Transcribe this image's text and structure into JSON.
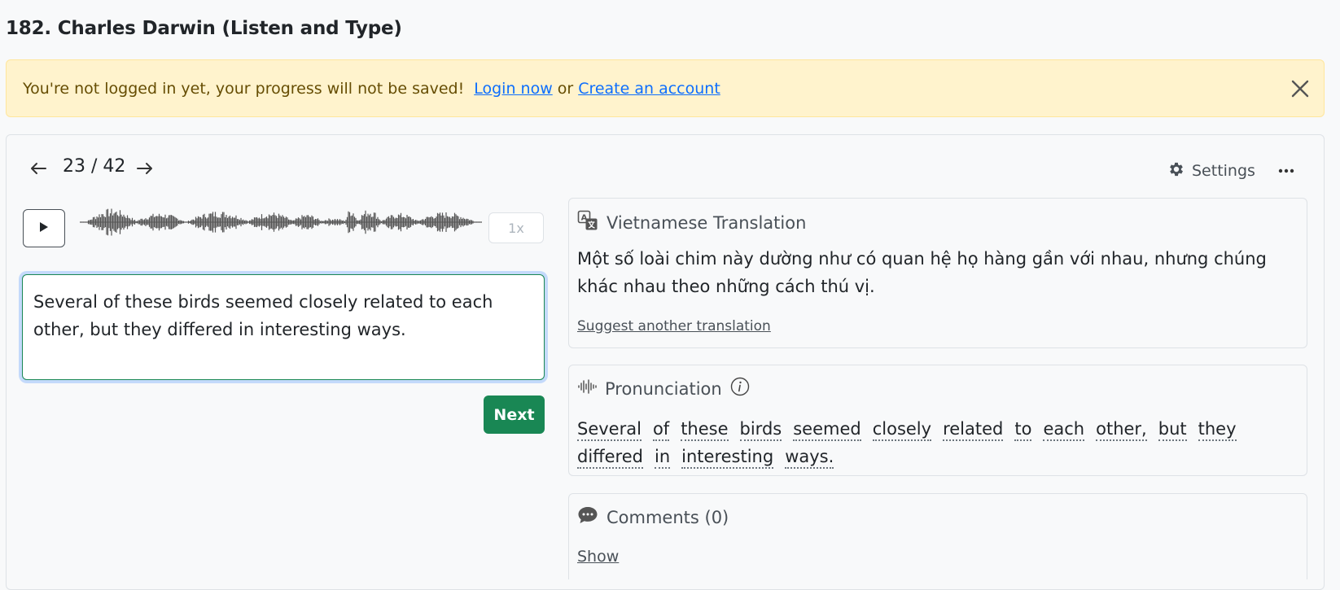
{
  "page": {
    "title": "182. Charles Darwin (Listen and Type)"
  },
  "alert": {
    "message": "You're not logged in yet, your progress will not be saved!",
    "login_link": "Login now",
    "separator": "or",
    "signup_link": "Create an account",
    "close_icon": "close-icon"
  },
  "navigation": {
    "prev_icon": "arrow-left-icon",
    "next_icon": "arrow-right-icon",
    "counter": "23 / 42"
  },
  "toolbar": {
    "settings_label": "Settings",
    "settings_icon": "gear-icon",
    "more_icon": "more-horizontal-icon"
  },
  "player": {
    "play_icon": "play-icon",
    "speed_label": "1x"
  },
  "answer": {
    "value": "Several of these birds seemed closely related to each other, but they differed in interesting ways."
  },
  "actions": {
    "next_label": "Next"
  },
  "translation": {
    "icon": "translate-icon",
    "title": "Vietnamese Translation",
    "text": "Một số loài chim này dường như có quan hệ họ hàng gần với nhau, nhưng chúng khác nhau theo những cách thú vị.",
    "suggest_link": "Suggest another translation"
  },
  "pronunciation": {
    "icon": "audio-waves-icon",
    "title": "Pronunciation",
    "info_icon": "info-icon",
    "words": [
      "Several",
      "of",
      "these",
      "birds",
      "seemed",
      "closely",
      "related",
      "to",
      "each",
      "other,",
      "but",
      "they",
      "differed",
      "in",
      "interesting",
      "ways."
    ]
  },
  "comments": {
    "icon": "chat-bubble-icon",
    "title": "Comments (0)",
    "show_link": "Show"
  },
  "colors": {
    "alert_bg": "#fff3cd",
    "alert_text": "#664d03",
    "link": "#0d6efd",
    "success": "#198754",
    "page_bg": "#f8f9fa"
  }
}
